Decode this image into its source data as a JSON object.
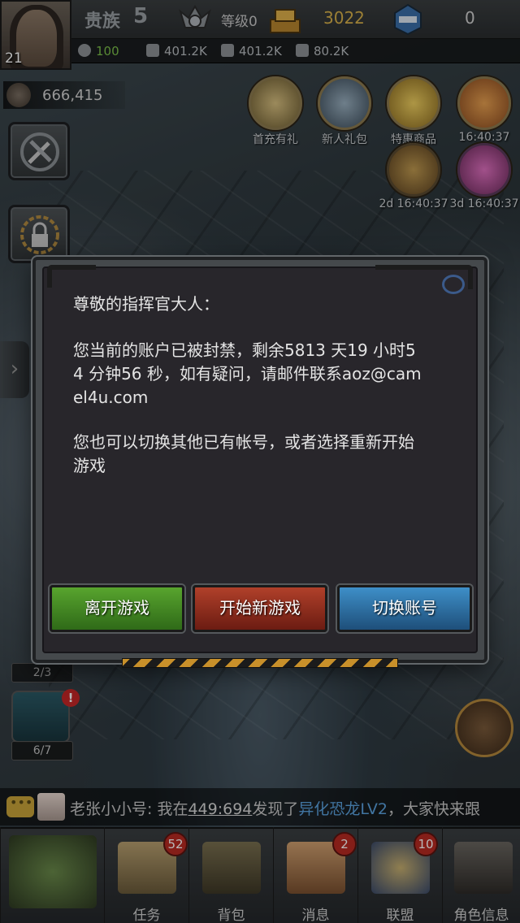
{
  "player": {
    "level": "21",
    "noble_label": "贵族",
    "noble_level": "5",
    "rank_label": "等级0",
    "gold": "3022",
    "gems": "0",
    "power": "666,415"
  },
  "stats": {
    "vip": "100",
    "food": "401.2K",
    "oil": "401.2K",
    "steel": "80.2K"
  },
  "events": [
    {
      "label": "首充有礼"
    },
    {
      "label": "新人礼包"
    },
    {
      "label": "特惠商品"
    },
    {
      "label": "16:40:37"
    },
    {
      "label": "2d 16:40:37"
    },
    {
      "label": "3d 16:40:37"
    }
  ],
  "counters": {
    "top": "2/3",
    "bottom": "6/7"
  },
  "alert_mark": "!",
  "chat": {
    "sender": "老张小小号:",
    "text_a": " 我在",
    "coord": "449:694",
    "text_b": "发现了",
    "monster": "异化恐龙LV2",
    "text_c": "，大家快来跟"
  },
  "modal": {
    "greeting": "尊敬的指挥官大人：",
    "line1": "您当前的账户已被封禁，剩余5813 天19 小时5",
    "line2": "4 分钟56 秒，如有疑问，请邮件联系aoz@cam",
    "line3": "el4u.com",
    "line4": "您也可以切换其他已有帐号，或者选择重新开始",
    "line5": "游戏",
    "btn_leave": "离开游戏",
    "btn_new": "开始新游戏",
    "btn_switch": "切换账号"
  },
  "nav": [
    {
      "label": "",
      "badge": ""
    },
    {
      "label": "任务",
      "badge": "52"
    },
    {
      "label": "背包",
      "badge": ""
    },
    {
      "label": "消息",
      "badge": "2"
    },
    {
      "label": "联盟",
      "badge": "10"
    },
    {
      "label": "角色信息",
      "badge": ""
    }
  ],
  "colors": {
    "gold": "#d8b24a",
    "green_btn": "#58a42e",
    "red_btn": "#b0402a",
    "blue_btn": "#3e8fc8",
    "monster": "#5aa2e0"
  }
}
